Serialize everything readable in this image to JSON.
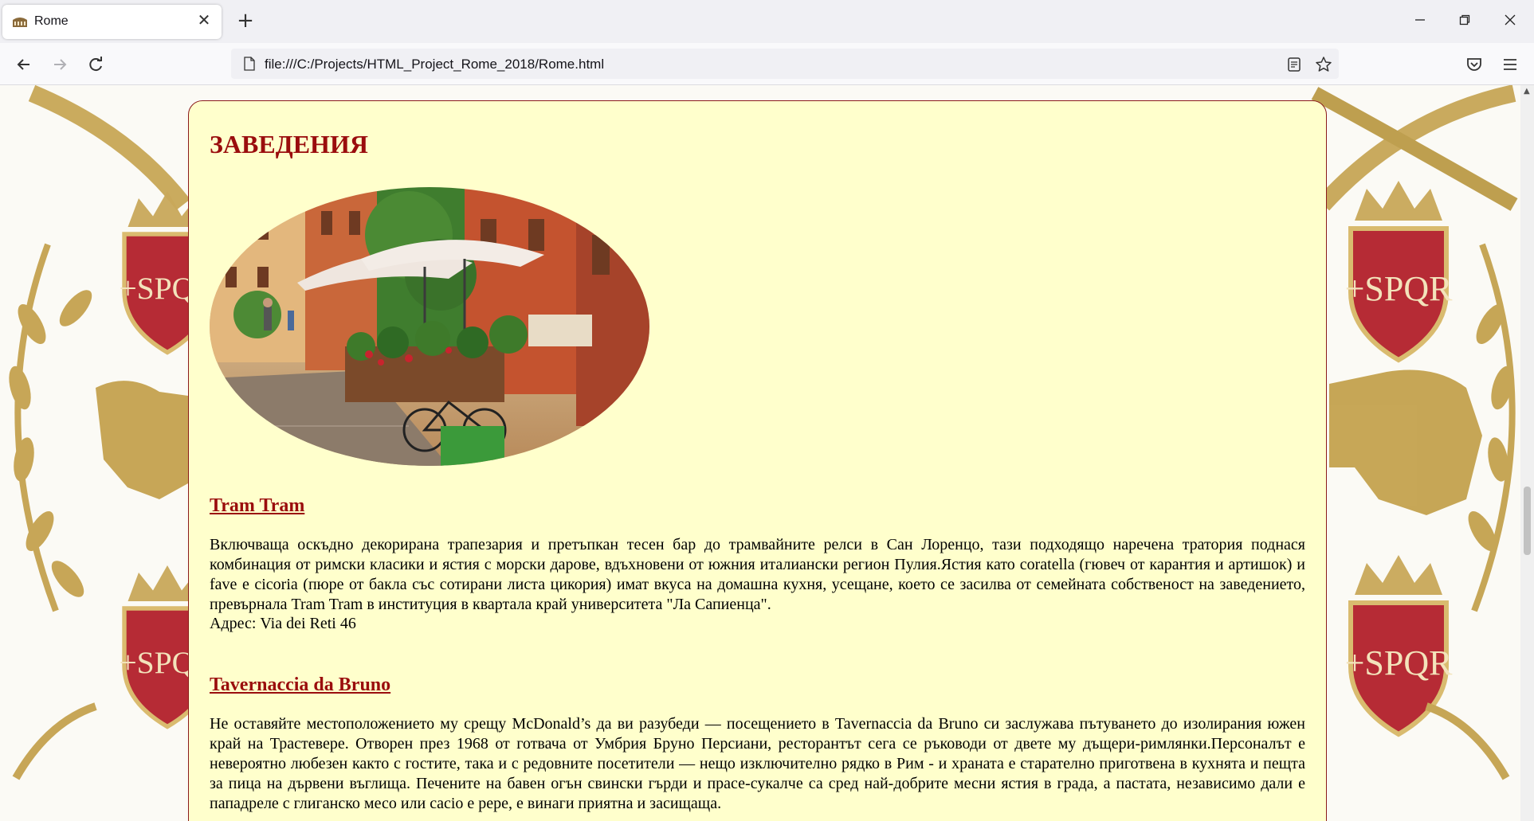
{
  "browser": {
    "tab_title": "Rome",
    "url": "file:///C:/Projects/HTML_Project_Rome_2018/Rome.html"
  },
  "page": {
    "heading": "ЗАВЕДЕНИЯ",
    "venues": [
      {
        "name": "Tram Tram",
        "description": "Включваща оскъдно декорирана трапезария и претъпкан тесен бар до трамвайните релси в Сан Лоренцо, тази подходящо наречена тратория поднася комбинация от римски класики и ястия с морски дарове, вдъхновени от южния италиански регион Пулия.Ястия като coratella (гювеч от карантия и артишок) и fave e cicoria (пюре от бакла със сотирани листа цикория) имат вкуса на домашна кухня, усещане, което се засилва от семейната собственост на заведението, превърнала Tram Tram в институция в квартала край университета \"Ла Сапиенца\".",
        "address": "Адрес: Via dei Reti 46"
      },
      {
        "name": "Tavernaccia da Bruno",
        "description": "Не оставяйте местоположението му срещу McDonald’s да ви разубеди — посещението в Tavernaccia da Bruno си заслужава пътуването до изолирания южен край на Трастевере. Отворен през 1968 от готвача от Умбрия Бруно Персиани, ресторантът сега се ръководи от двете му дъщери-римлянки.Персоналът е невероятно любезен както с гостите, така и с редовните посетители — нещо изключително рядко в Рим - и храната е старателно приготвена в кухнята и пещта за пица на дървени въглища. Печените на бавен огън свински гърди и прасе-сукалче са сред най-добрите месни ястия в града, а пастата, независимо дали е пападреле с глиганско месо или cacio e pepe, е винаги приятна и засищаща."
      }
    ]
  },
  "colors": {
    "heading": "#9a0d0d",
    "content_bg": "#ffffcc",
    "laurel_gold": "#c4a24e",
    "shield_red": "#b3202b"
  }
}
